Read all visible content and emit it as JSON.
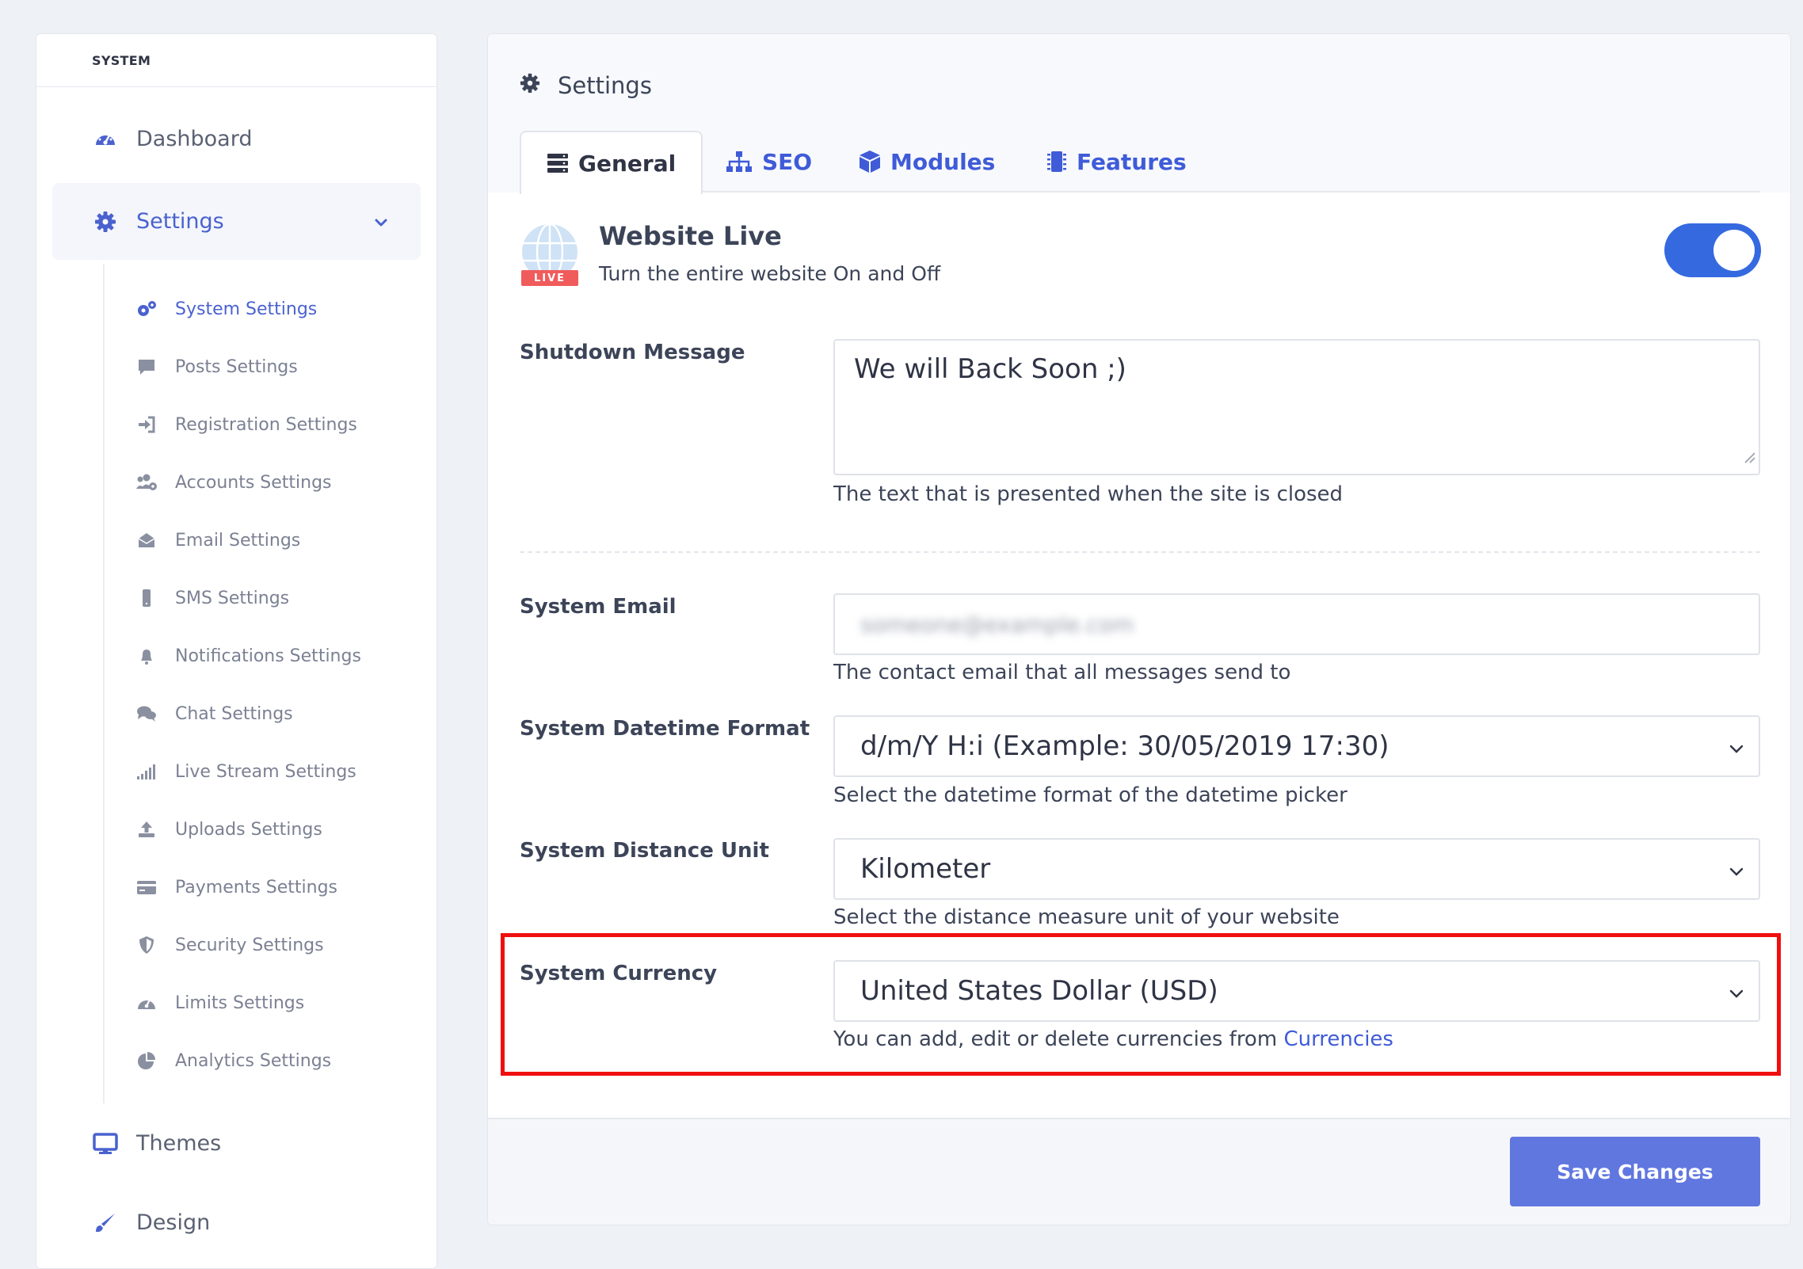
{
  "sidebar": {
    "header": "SYSTEM",
    "nav": {
      "dashboard": "Dashboard",
      "settings": "Settings",
      "themes": "Themes",
      "design": "Design"
    },
    "sub_items": [
      {
        "label": "System Settings",
        "icon": "cogs-icon"
      },
      {
        "label": "Posts Settings",
        "icon": "comment-icon"
      },
      {
        "label": "Registration Settings",
        "icon": "sign-in-icon"
      },
      {
        "label": "Accounts Settings",
        "icon": "users-cog-icon"
      },
      {
        "label": "Email Settings",
        "icon": "envelope-open-icon"
      },
      {
        "label": "SMS Settings",
        "icon": "mobile-icon"
      },
      {
        "label": "Notifications Settings",
        "icon": "bell-icon"
      },
      {
        "label": "Chat Settings",
        "icon": "comments-icon"
      },
      {
        "label": "Live Stream Settings",
        "icon": "signal-icon"
      },
      {
        "label": "Uploads Settings",
        "icon": "upload-icon"
      },
      {
        "label": "Payments Settings",
        "icon": "credit-card-icon"
      },
      {
        "label": "Security Settings",
        "icon": "shield-icon"
      },
      {
        "label": "Limits Settings",
        "icon": "gauge-icon"
      },
      {
        "label": "Analytics Settings",
        "icon": "pie-chart-icon"
      }
    ]
  },
  "main": {
    "title": "Settings",
    "tabs": {
      "general": "General",
      "seo": "SEO",
      "modules": "Modules",
      "features": "Features"
    },
    "website_live": {
      "badge": "LIVE",
      "title": "Website Live",
      "description": "Turn the entire website On and Off",
      "enabled": true
    },
    "shutdown": {
      "label": "Shutdown Message",
      "value": "We will Back Soon ;)",
      "help": "The text that is presented when the site is closed"
    },
    "email": {
      "label": "System Email",
      "value": "someone@example.com",
      "help": "The contact email that all messages send to"
    },
    "datetime": {
      "label": "System Datetime Format",
      "value": "d/m/Y H:i (Example: 30/05/2019 17:30)",
      "help": "Select the datetime format of the datetime picker"
    },
    "distance": {
      "label": "System Distance Unit",
      "value": "Kilometer",
      "help": "Select the distance measure unit of your website"
    },
    "currency": {
      "label": "System Currency",
      "value": "United States Dollar (USD)",
      "help_prefix": "You can add, edit or delete currencies from ",
      "help_link": "Currencies"
    },
    "save_label": "Save Changes"
  },
  "colors": {
    "accent": "#3f5bd8",
    "toggle": "#3569e0",
    "save_button": "#6177e0",
    "highlight": "#f00f0f"
  }
}
